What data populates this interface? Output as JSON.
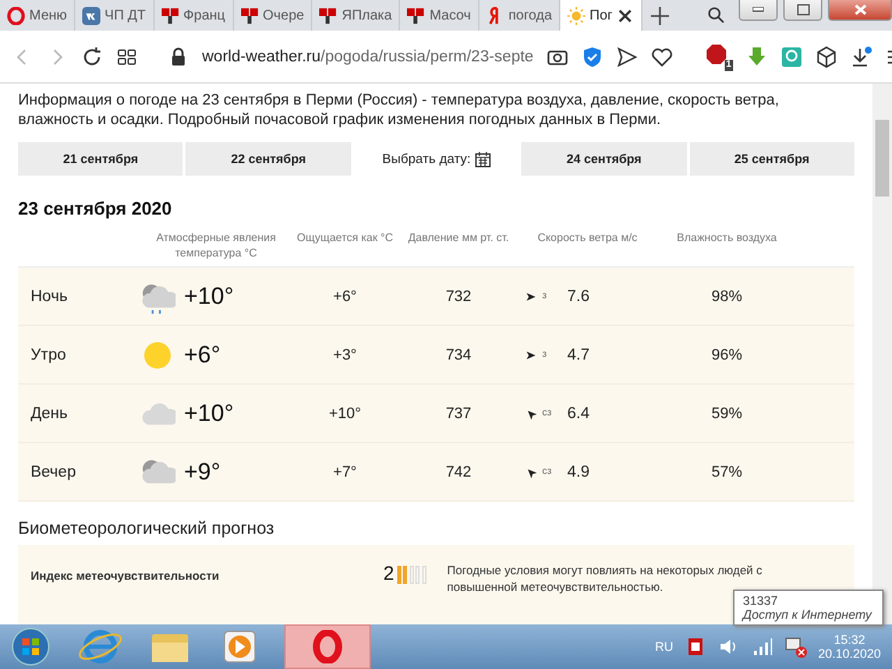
{
  "browser": {
    "tabs": [
      {
        "kind": "opera",
        "title": "Меню",
        "selected": false
      },
      {
        "kind": "vk",
        "title": "ЧП ДТ",
        "selected": false
      },
      {
        "kind": "yaplakal",
        "title": "Франц",
        "selected": false
      },
      {
        "kind": "yaplakal",
        "title": "Очере",
        "selected": false
      },
      {
        "kind": "yaplakal",
        "title": "ЯПлака",
        "selected": false
      },
      {
        "kind": "yaplakal",
        "title": "Масоч",
        "selected": false
      },
      {
        "kind": "yandex",
        "title": "погода",
        "selected": false
      },
      {
        "kind": "weather",
        "title": "Пог",
        "selected": true
      }
    ],
    "address": {
      "host": "world-weather.ru",
      "path": "/pogoda/russia/perm/23-septe"
    },
    "adblock_count": "1"
  },
  "page": {
    "intro": "Информация о погоде на 23 сентября в Перми (Россия) - температура воздуха, давление, скорость ветра, влажность и осадки. Подробный почасовой график изменения погодных данных в Перми.",
    "date_tabs": [
      {
        "kind": "day",
        "label": "21 сентября"
      },
      {
        "kind": "day",
        "label": "22 сентября"
      },
      {
        "kind": "picker",
        "label": "Выбрать дату:"
      },
      {
        "kind": "day",
        "label": "24 сентября"
      },
      {
        "kind": "day",
        "label": "25 сентября"
      }
    ],
    "heading": "23 сентября 2020",
    "columns": [
      "Атмосферные явления температура °С",
      "Ощущается как °С",
      "Давление мм рт. ст.",
      "Скорость ветра м/с",
      "Влажность воздуха"
    ],
    "rows": [
      {
        "period": "Ночь",
        "kind": "rain-cloud",
        "temp": "+10°",
        "feels": "+6°",
        "pressure": "732",
        "wind": {
          "kind": "east",
          "direction": "з",
          "speed": "7.6"
        },
        "humidity": "98%"
      },
      {
        "period": "Утро",
        "kind": "sun",
        "temp": "+6°",
        "feels": "+3°",
        "pressure": "734",
        "wind": {
          "kind": "east",
          "direction": "з",
          "speed": "4.7"
        },
        "humidity": "96%"
      },
      {
        "period": "День",
        "kind": "cloud",
        "temp": "+10°",
        "feels": "+10°",
        "pressure": "737",
        "wind": {
          "kind": "northwest",
          "direction": "сз",
          "speed": "6.4"
        },
        "humidity": "59%"
      },
      {
        "period": "Вечер",
        "kind": "partly-cloudy",
        "temp": "+9°",
        "feels": "+7°",
        "pressure": "742",
        "wind": {
          "kind": "northwest",
          "direction": "сз",
          "speed": "4.9"
        },
        "humidity": "57%"
      }
    ],
    "bio_heading": "Биометеорологический прогноз",
    "bio": {
      "label": "Индекс метеочувствительности",
      "value": "2",
      "level": 0.4,
      "text": "Погодные условия могут повлиять на некоторых людей с повышенной метеочувствительностью."
    }
  },
  "tooltip": {
    "title": "31337",
    "text": "Доступ к Интернету"
  },
  "taskbar": {
    "language": "RU",
    "time": "15:32",
    "date": "20.10.2020"
  }
}
